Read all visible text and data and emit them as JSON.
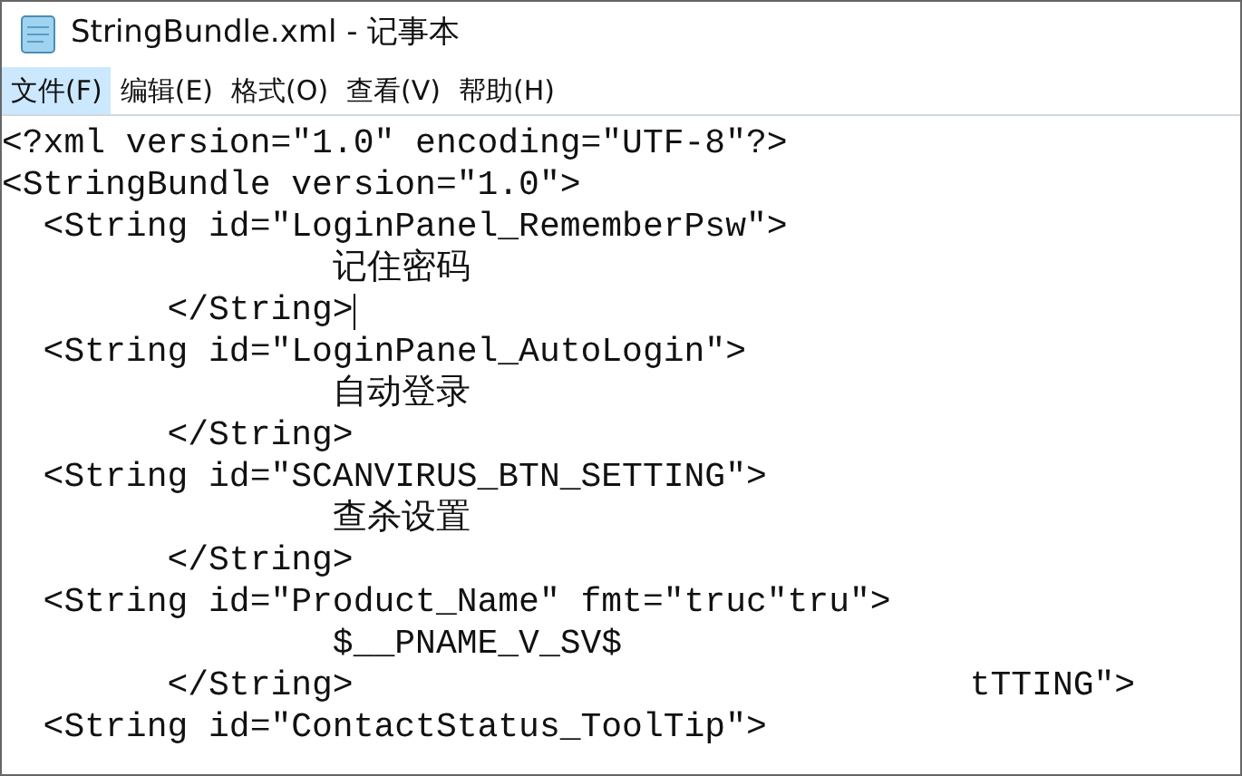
{
  "window": {
    "title": "StringBundle.xml - 记事本"
  },
  "menu": [
    {
      "label": "文件(F)",
      "selected": true
    },
    {
      "label": "编辑(E)",
      "selected": false
    },
    {
      "label": "格式(O)",
      "selected": false
    },
    {
      "label": "查看(V)",
      "selected": false
    },
    {
      "label": "帮助(H)",
      "selected": false
    }
  ],
  "lines": [
    {
      "text": "<?xml version=\"1.0\" encoding=\"UTF-8\"?>",
      "caret": false
    },
    {
      "text": "<StringBundle version=\"1.0\">",
      "caret": false
    },
    {
      "text": "  <String id=\"LoginPanel_RememberPsw\">",
      "caret": false
    },
    {
      "text": "                记住密码",
      "caret": false
    },
    {
      "text": "        </String>",
      "caret": true
    },
    {
      "text": "  <String id=\"LoginPanel_AutoLogin\">",
      "caret": false
    },
    {
      "text": "                自动登录",
      "caret": false
    },
    {
      "text": "        </String>",
      "caret": false
    },
    {
      "text": "  <String id=\"SCANVIRUS_BTN_SETTING\">",
      "caret": false
    },
    {
      "text": "                查杀设置",
      "caret": false
    },
    {
      "text": "        </String>",
      "caret": false
    },
    {
      "text": "  <String id=\"Product_Name\" fmt=\"truc\"tru\">",
      "caret": false
    },
    {
      "text": "                $__PNAME_V_SV$",
      "caret": false
    },
    {
      "text": "        </String>",
      "caret": false,
      "stray": "tTTING\">"
    },
    {
      "text": "  <String id=\"ContactStatus_ToolTip\">",
      "caret": false
    }
  ]
}
